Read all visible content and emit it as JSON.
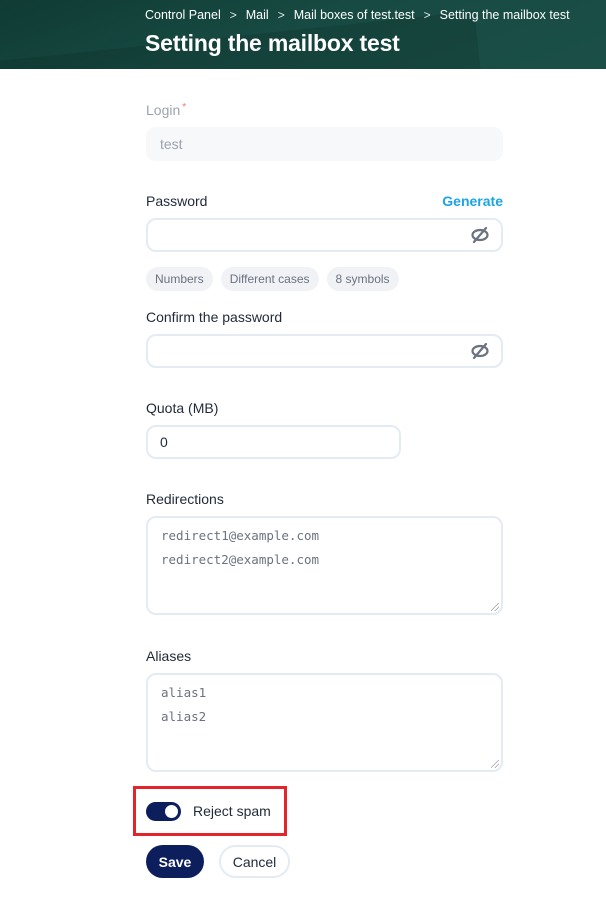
{
  "header": {
    "breadcrumb": [
      "Control Panel",
      "Mail",
      "Mail boxes of test.test",
      "Setting the mailbox test"
    ],
    "breadcrumb_separator": ">",
    "title": "Setting the mailbox test"
  },
  "form": {
    "login": {
      "label": "Login",
      "required_mark": "*",
      "value": "test",
      "disabled": true
    },
    "password": {
      "label": "Password",
      "generate_label": "Generate",
      "value": "",
      "toggle_icon": "eye-slash-icon",
      "hints": [
        "Numbers",
        "Different cases",
        "8 symbols"
      ]
    },
    "confirm_password": {
      "label": "Confirm the password",
      "value": "",
      "toggle_icon": "eye-slash-icon"
    },
    "quota": {
      "label": "Quota (MB)",
      "value": "0"
    },
    "redirections": {
      "label": "Redirections",
      "placeholder_lines": [
        "redirect1@example.com",
        "redirect2@example.com"
      ]
    },
    "aliases": {
      "label": "Aliases",
      "placeholder_lines": [
        "alias1",
        "alias2"
      ]
    },
    "reject_spam": {
      "label": "Reject spam",
      "checked": true
    }
  },
  "actions": {
    "save_label": "Save",
    "cancel_label": "Cancel"
  },
  "colors": {
    "header_bg": "#174a42",
    "primary": "#0c1f5c",
    "link": "#1aa5e6",
    "highlight": "#e3242b"
  }
}
